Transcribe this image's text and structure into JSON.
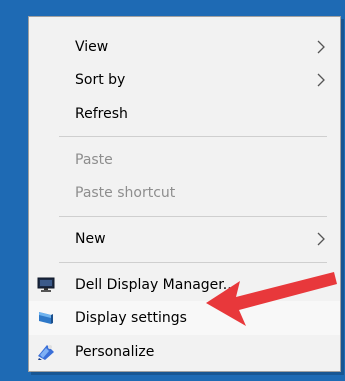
{
  "menu": {
    "view": "View",
    "sort_by": "Sort by",
    "refresh": "Refresh",
    "paste": "Paste",
    "paste_shortcut": "Paste shortcut",
    "new": "New",
    "dell_display_manager": "Dell Display Manager...",
    "display_settings": "Display settings",
    "personalize": "Personalize"
  },
  "colors": {
    "desktop": "#1e6ab4",
    "menu_bg": "#f2f2f2",
    "arrow": "#e8383b"
  },
  "icons": {
    "submenu": "chevron-right-icon",
    "dell": "monitor-icon",
    "display": "display-settings-icon",
    "personalize": "personalize-icon",
    "annotation": "red-arrow-annotation"
  }
}
